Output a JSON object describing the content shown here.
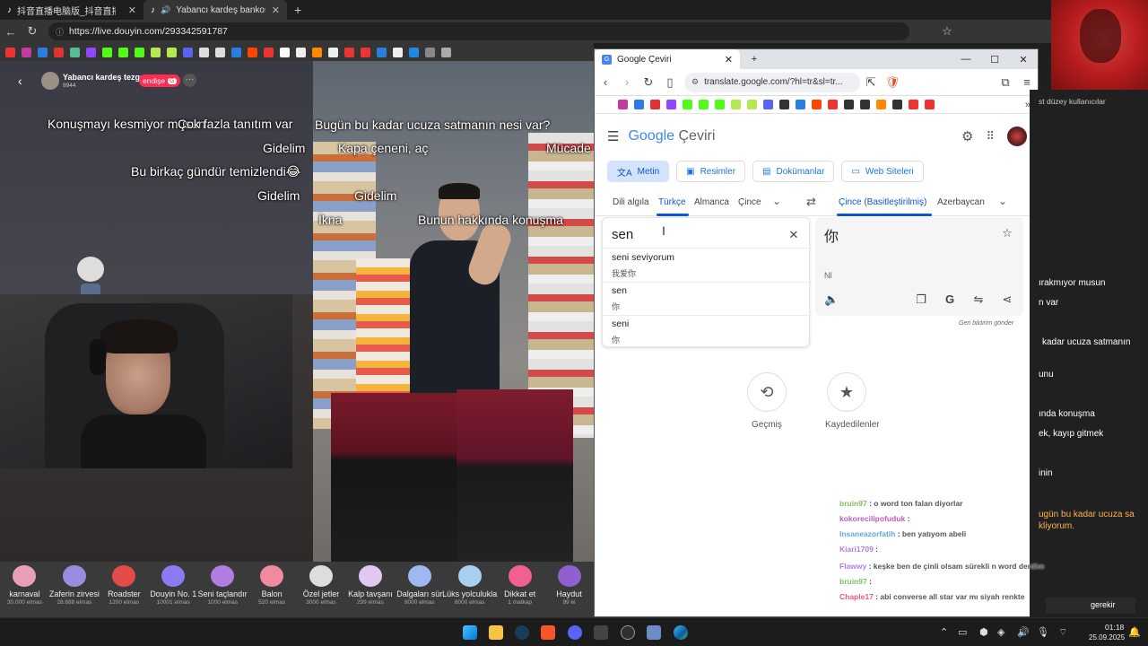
{
  "back_browser": {
    "tabs": [
      {
        "label": "抖音直播电脑版_抖音直播网页版"
      },
      {
        "label": "Yabancı kardeş bankosunun"
      }
    ],
    "url": "https://live.douyin.com/293342591787"
  },
  "douyin": {
    "streamer_name": "Yabancı kardeş tezga",
    "viewer_count": "9944",
    "badge": "endişe",
    "badge_count": "G",
    "subtitles_left": [
      "Konuşmayı kesmiyor musun",
      "Çok fazla tanıtım var",
      "Gidelim",
      "Bu birkaç gündür temizlendi😂",
      "Gidelim"
    ],
    "subtitles_video": [
      "Bugün bu kadar ucuza satmanın nesi var?",
      "Kapa çeneni, aç",
      "Mücade",
      "Gidelim",
      "İkna",
      "Bunun hakkında konuşma"
    ],
    "gifts": [
      {
        "name": "karnaval",
        "price": "30.000 elmas",
        "color": "#e8a0b6"
      },
      {
        "name": "Zaferin zirvesi",
        "price": "28.888 elmas",
        "color": "#9a8de0"
      },
      {
        "name": "Roadster",
        "price": "1200 elmas",
        "color": "#e34b4b"
      },
      {
        "name": "Douyin No. 1",
        "price": "10001 elmas",
        "color": "#8b7bf0"
      },
      {
        "name": "Seni taçlandır",
        "price": "1000 elmas",
        "color": "#b07de0"
      },
      {
        "name": "Balon",
        "price": "520 elmas",
        "color": "#f08aa0"
      },
      {
        "name": "Özel jetler",
        "price": "3000 elmas",
        "color": "#dddddd"
      },
      {
        "name": "Kalp tavşanı",
        "price": "299 elmas",
        "color": "#e0c8f0"
      },
      {
        "name": "Dalgaları sür",
        "price": "8000 elmas",
        "color": "#9fb8f0"
      },
      {
        "name": "Lüks yolculukla",
        "price": "6000 elmas",
        "color": "#a8d0f0"
      },
      {
        "name": "Dikkat et",
        "price": "1 matkap",
        "color": "#f06090"
      },
      {
        "name": "Haydut",
        "price": "99 el",
        "color": "#9060d0"
      }
    ]
  },
  "translate": {
    "tab_title": "Google Çeviri",
    "url": "translate.google.com/?hl=tr&sl=tr...",
    "logo_google": "Google",
    "logo_ceviri": "Çeviri",
    "modes": [
      "Metin",
      "Resimler",
      "Dokümanlar",
      "Web Siteleri"
    ],
    "source_langs": [
      "Dili algıla",
      "Türkçe",
      "Almanca",
      "Çince"
    ],
    "target_langs": [
      "Çince (Basitleştirilmiş)",
      "Azerbaycan"
    ],
    "input_text": "sen",
    "output_text": "你",
    "romanization": "Nǐ",
    "suggestions": [
      {
        "text": "seni seviyorum",
        "translation": "我爱你"
      },
      {
        "text": "sen",
        "translation": "你"
      },
      {
        "text": "seni",
        "translation": "你"
      }
    ],
    "feedback": "Geri bildirim gönder",
    "history_label": "Geçmiş",
    "saved_label": "Kaydedilenler"
  },
  "right_panel": {
    "header": "st düzey kullanıcılar",
    "lines": [
      "ırakmıyor musun",
      "n var",
      "kadar ucuza satmanın",
      "unu",
      "ında konuşma",
      "ek, kayıp gitmek",
      "inin",
      "ugün bu kadar ucuza sa",
      "kliyorum."
    ]
  },
  "chat": [
    {
      "user": "bruin97",
      "msg": "o word ton falan diyorlar",
      "color": "#7fbf5f"
    },
    {
      "user": "kokorecilipofuduk",
      "msg": "",
      "color": "#c05ac0"
    },
    {
      "user": "Insaneazorfatih",
      "msg": "ben yatıyom abeli",
      "color": "#5fa8e0"
    },
    {
      "user": "Kiari1709",
      "msg": "",
      "color": "#b07de0"
    },
    {
      "user": "Flawwy",
      "msg": "keşke ben de çinli olsam sürekli n word derdim",
      "color": "#b07de0"
    },
    {
      "user": "bruin97",
      "msg": "",
      "color": "#7fbf5f"
    },
    {
      "user": "Chaple17",
      "msg": "abi converse all star var mı siyah renkte",
      "color": "#e05a8a"
    }
  ],
  "chat_overflow": "gerekir",
  "clock": {
    "time": "01:18",
    "date": "25.09.2025"
  }
}
